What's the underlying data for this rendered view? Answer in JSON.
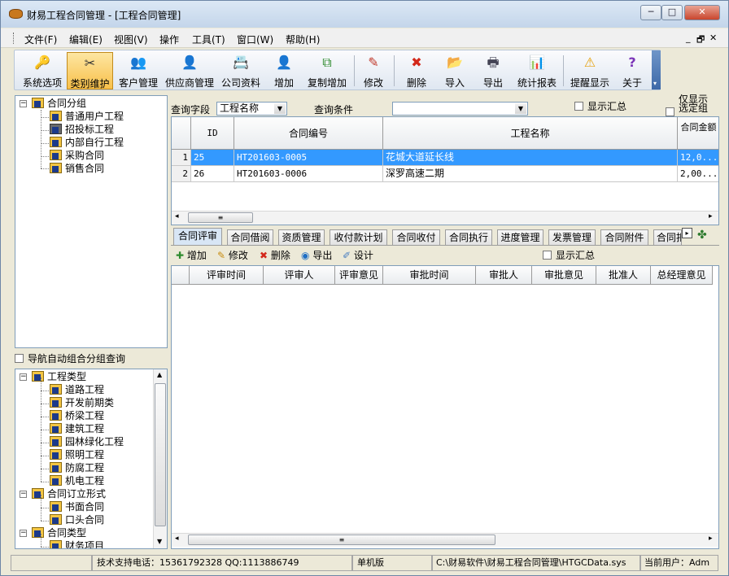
{
  "window": {
    "title": "财易工程合同管理 - [工程合同管理]",
    "min": "─",
    "max": "□",
    "close": "✕"
  },
  "menu": [
    "文件(F)",
    "编辑(E)",
    "视图(V)",
    "操作",
    "工具(T)",
    "窗口(W)",
    "帮助(H)"
  ],
  "mdi_controls": [
    "_",
    "🗗",
    "✕"
  ],
  "toolbar": [
    {
      "label": "系统选项",
      "icon": "key-icon",
      "glyph": "🔑"
    },
    {
      "label": "类别维护",
      "icon": "tools-icon",
      "glyph": "✂",
      "active": true
    },
    {
      "label": "客户管理",
      "icon": "customer-icon",
      "glyph": "👥"
    },
    {
      "label": "供应商管理",
      "icon": "supplier-icon",
      "glyph": "👤"
    },
    {
      "label": "公司资料",
      "icon": "company-icon",
      "glyph": "📇"
    },
    {
      "label": "增加",
      "icon": "add-user-icon",
      "glyph": "👤"
    },
    {
      "label": "复制增加",
      "icon": "copy-add-icon",
      "glyph": "⧉"
    },
    {
      "label": "修改",
      "icon": "pencil-icon",
      "glyph": "✎"
    },
    {
      "label": "删除",
      "icon": "delete-icon",
      "glyph": "✖"
    },
    {
      "label": "导入",
      "icon": "import-icon",
      "glyph": "📂"
    },
    {
      "label": "导出",
      "icon": "printer-icon",
      "glyph": "🖶"
    },
    {
      "label": "统计报表",
      "icon": "chart-icon",
      "glyph": "📊"
    },
    {
      "label": "提醒显示",
      "icon": "warning-icon",
      "glyph": "⚠"
    },
    {
      "label": "关于",
      "icon": "help-icon",
      "glyph": "?"
    }
  ],
  "left_tree_top": {
    "root": "合同分组",
    "children": [
      "普通用户工程",
      "招投标工程",
      "内部自行工程",
      "采购合同",
      "销售合同"
    ]
  },
  "nav_auto_group": "导航自动组合分组查询",
  "left_tree_bottom": [
    {
      "label": "工程类型",
      "level": 0
    },
    {
      "label": "道路工程",
      "level": 1
    },
    {
      "label": "开发前期类",
      "level": 1
    },
    {
      "label": "桥梁工程",
      "level": 1
    },
    {
      "label": "建筑工程",
      "level": 1
    },
    {
      "label": "园林绿化工程",
      "level": 1
    },
    {
      "label": "照明工程",
      "level": 1
    },
    {
      "label": "防腐工程",
      "level": 1
    },
    {
      "label": "机电工程",
      "level": 1
    },
    {
      "label": "合同订立形式",
      "level": 0
    },
    {
      "label": "书面合同",
      "level": 1
    },
    {
      "label": "口头合同",
      "level": 1
    },
    {
      "label": "合同类型",
      "level": 0
    },
    {
      "label": "财务项目",
      "level": 1
    }
  ],
  "query": {
    "field_label": "查询字段",
    "field_value": "工程名称",
    "cond_label": "查询条件",
    "cond_value": "",
    "show_summary": "显示汇总",
    "only_selected_line1": "仅显示",
    "only_selected_line2": "选定组"
  },
  "main_grid": {
    "headers": [
      "ID",
      "合同编号",
      "工程名称",
      "合同金额"
    ],
    "rows": [
      {
        "num": "1",
        "id": "25",
        "code": "HT201603-0005",
        "name": "花城大道延长线",
        "amount": "12,0..."
      },
      {
        "num": "2",
        "id": "26",
        "code": "HT201603-0006",
        "name": "深罗高速二期",
        "amount": "2,00..."
      }
    ]
  },
  "tabs": [
    "合同评审",
    "合同借阅",
    "资质管理",
    "收付款计划",
    "合同收付",
    "合同执行",
    "进度管理",
    "发票管理",
    "合同附件",
    "合同扣"
  ],
  "sub_toolbar": {
    "add": "增加",
    "edit": "修改",
    "delete": "删除",
    "export": "导出",
    "design": "设计",
    "show_summary": "显示汇总"
  },
  "sub_grid_headers": [
    "评审时间",
    "评审人",
    "评审意见",
    "审批时间",
    "审批人",
    "审批意见",
    "批准人",
    "总经理意见"
  ],
  "statusbar": {
    "support": "技术支持电话：15361792328 QQ:1113886749",
    "mode": "单机版",
    "path": "C:\\财易软件\\财易工程合同管理\\HTGCData.sys",
    "user": "当前用户：Adm"
  },
  "colors": {
    "selection": "#3399ff",
    "toolbar_active": "#f8c04a",
    "tab_active": "#d8e6f5"
  }
}
